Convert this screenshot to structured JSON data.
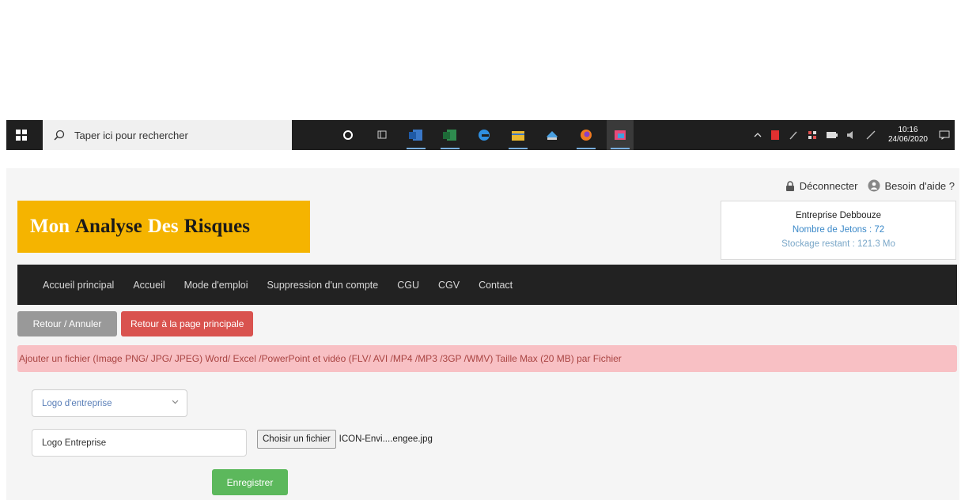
{
  "taskbar": {
    "search_placeholder": "Taper ici pour rechercher",
    "clock_time": "10:16",
    "clock_date": "24/06/2020",
    "apps": [
      "cortana-circle-icon",
      "task-view-icon",
      "outlook-icon",
      "excel-icon",
      "edge-icon",
      "file-explorer-icon",
      "app-icon",
      "firefox-icon",
      "paint-icon"
    ]
  },
  "userbar": {
    "logout": "Déconnecter",
    "help": "Besoin d'aide ?"
  },
  "logo": {
    "words": [
      "Mon",
      "Analyse",
      "Des",
      "Risques"
    ]
  },
  "company": {
    "name": "Entreprise Debbouze",
    "tokens": "Nombre de Jetons : 72",
    "storage": "Stockage restant : 121.3 Mo"
  },
  "nav": {
    "items": [
      "Accueil principal",
      "Accueil",
      "Mode d'emploi",
      "Suppression d'un compte",
      "CGU",
      "CGV",
      "Contact"
    ]
  },
  "buttons": {
    "back": "Retour / Annuler",
    "home": "Retour à la page principale"
  },
  "alert": {
    "text": "Ajouter un fichier (Image PNG/ JPG/ JPEG) Word/ Excel /PowerPoint et vidéo (FLV/ AVI /MP4 /MP3 /3GP /WMV) Taille Max (20 MB) par Fichier"
  },
  "form": {
    "select_value": "Logo d'entreprise",
    "name_value": "Logo Entreprise",
    "file_button": "Choisir un fichier",
    "file_name": "ICON-Envi....engee.jpg",
    "save": "Enregistrer"
  },
  "colors": {
    "logo_bg": "#f5b400",
    "navbar_bg": "#222222",
    "alert_bg": "#f8c0c4",
    "save_bg": "#5cb85c",
    "danger": "#d9534f"
  }
}
